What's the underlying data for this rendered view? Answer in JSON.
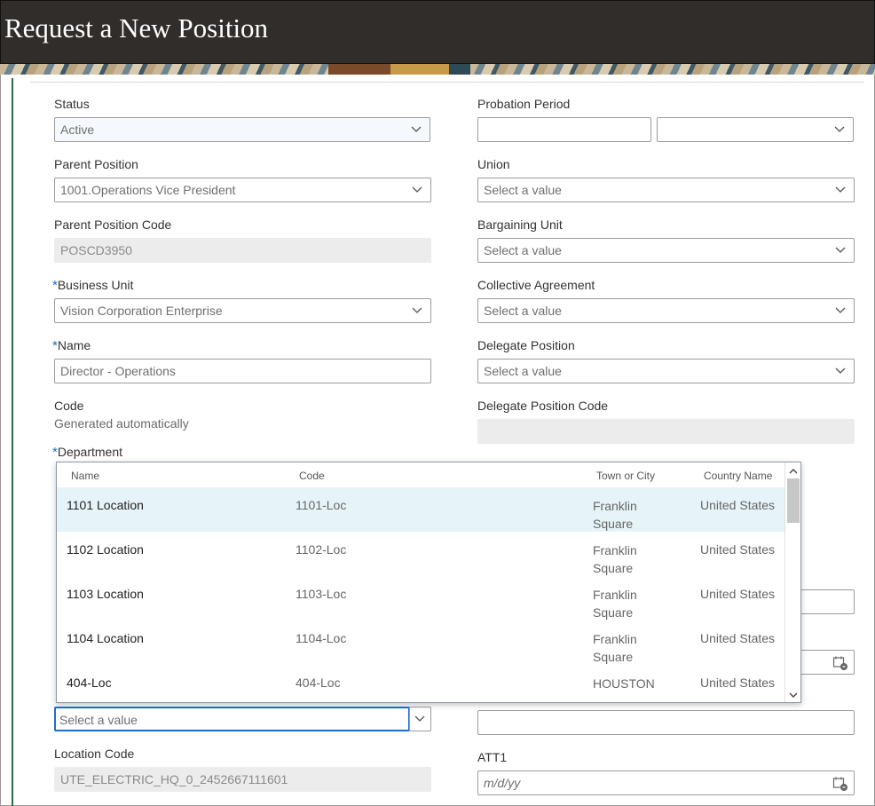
{
  "header": {
    "title": "Request a New Position"
  },
  "left": {
    "status": {
      "label": "Status",
      "value": "Active"
    },
    "parent_position": {
      "label": "Parent Position",
      "value": "1001.Operations Vice President"
    },
    "parent_position_code": {
      "label": "Parent Position Code",
      "value": "POSCD3950"
    },
    "business_unit": {
      "required": "*",
      "label": "Business Unit",
      "value": "Vision Corporation Enterprise"
    },
    "name": {
      "required": "*",
      "label": "Name",
      "value": "Director - Operations"
    },
    "code": {
      "label": "Code",
      "value": "Generated automatically"
    },
    "department": {
      "required": "*",
      "label": "Department"
    },
    "location": {
      "placeholder": "Select a value"
    },
    "location_code": {
      "label": "Location Code",
      "value": "UTE_ELECTRIC_HQ_0_2452667111601"
    }
  },
  "right": {
    "probation_period": {
      "label": "Probation Period"
    },
    "union": {
      "label": "Union",
      "placeholder": "Select a value"
    },
    "bargaining_unit": {
      "label": "Bargaining Unit",
      "placeholder": "Select a value"
    },
    "collective_agreement": {
      "label": "Collective Agreement",
      "placeholder": "Select a value"
    },
    "delegate_position": {
      "label": "Delegate Position",
      "placeholder": "Select a value"
    },
    "delegate_position_code": {
      "label": "Delegate Position Code"
    },
    "att1": {
      "label": "ATT1",
      "placeholder": "m/d/yy"
    }
  },
  "dropdown": {
    "columns": [
      "Name",
      "Code",
      "Town or City",
      "Country Name"
    ],
    "rows": [
      {
        "name": "1101 Location",
        "code": "1101-Loc",
        "town": "Franklin Square",
        "country": "United States"
      },
      {
        "name": "1102 Location",
        "code": "1102-Loc",
        "town": "Franklin Square",
        "country": "United States"
      },
      {
        "name": "1103 Location",
        "code": "1103-Loc",
        "town": "Franklin Square",
        "country": "United States"
      },
      {
        "name": "1104 Location",
        "code": "1104-Loc",
        "town": "Franklin Square",
        "country": "United States"
      },
      {
        "name": "404-Loc",
        "code": "404-Loc",
        "town": "HOUSTON",
        "country": "United States"
      }
    ]
  },
  "colors": {
    "header_bg": "#312d2a",
    "accent": "#1b6fd1",
    "highlight_row": "#e6f4fa",
    "left_bar": "#2e6b46"
  }
}
